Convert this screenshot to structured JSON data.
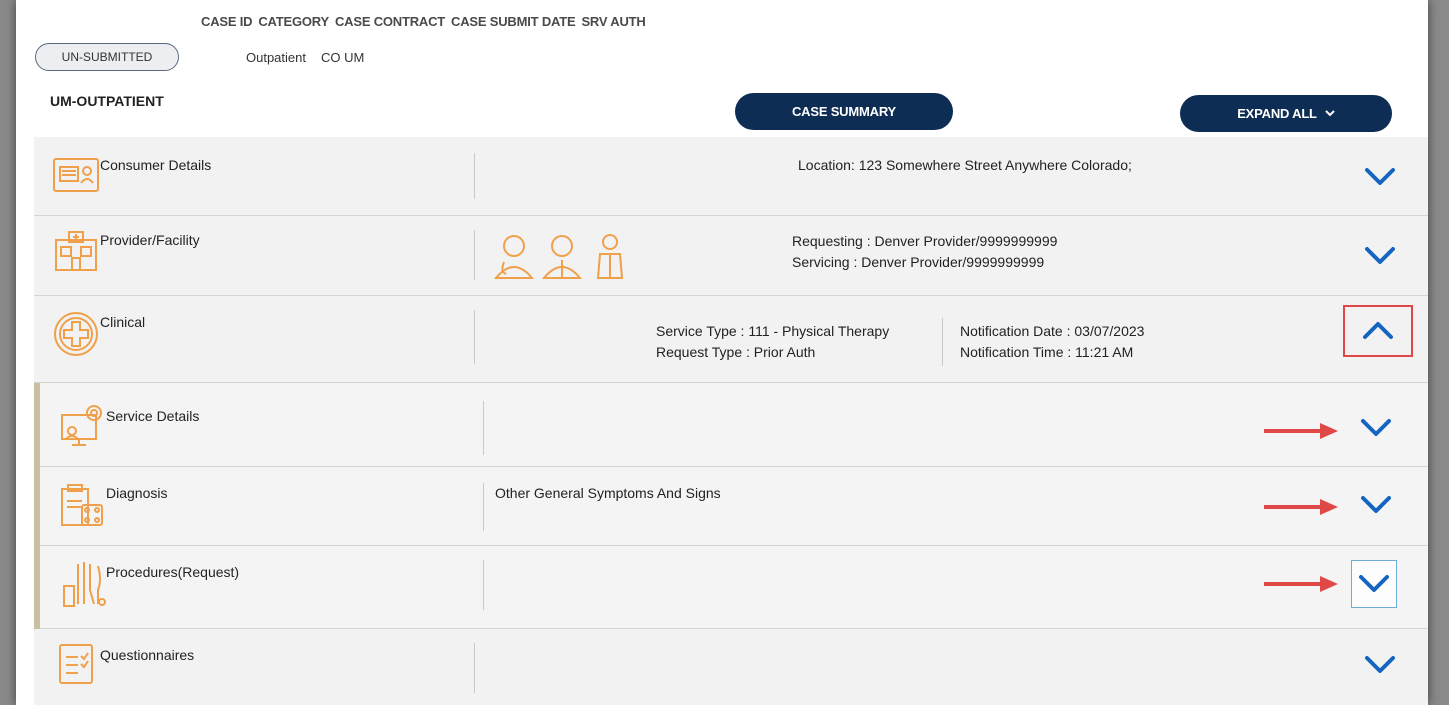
{
  "header": {
    "columns": [
      "CASE ID",
      "CATEGORY",
      "CASE CONTRACT",
      "CASE SUBMIT DATE",
      "SRV AUTH"
    ],
    "status": "UN-SUBMITTED",
    "category_value": "Outpatient",
    "contract_value": "CO UM"
  },
  "module_title": "UM-OUTPATIENT",
  "buttons": {
    "case_summary": "CASE SUMMARY",
    "expand_all": "EXPAND ALL"
  },
  "sections": {
    "consumer": {
      "title": "Consumer Details",
      "location": "Location: 123 Somewhere Street Anywhere Colorado;"
    },
    "provider": {
      "title": "Provider/Facility",
      "requesting": "Requesting : Denver Provider/9999999999",
      "servicing": "Servicing : Denver Provider/9999999999"
    },
    "clinical": {
      "title": "Clinical",
      "service_type": "Service Type : 111 - Physical Therapy",
      "request_type": "Request Type : Prior Auth",
      "notification_date": "Notification Date : 03/07/2023",
      "notification_time": "Notification Time : 11:21 AM"
    },
    "service_details": {
      "title": "Service Details"
    },
    "diagnosis": {
      "title": "Diagnosis",
      "value": "Other General Symptoms And Signs"
    },
    "procedures": {
      "title": "Procedures(Request)"
    },
    "questionnaires": {
      "title": "Questionnaires"
    }
  },
  "colors": {
    "icon_orange": "#f0a04b",
    "chevron_blue": "#1565c0",
    "button_navy": "#0e2d54",
    "highlight_red": "#e04848"
  },
  "icons": [
    "id-card-icon",
    "facility-icon",
    "clinical-cross-icon",
    "service-details-icon",
    "diagnosis-icon",
    "procedures-icon",
    "questionnaire-icon",
    "doctor-icon",
    "chevron-down-icon",
    "chevron-up-icon",
    "red-arrow-icon"
  ]
}
